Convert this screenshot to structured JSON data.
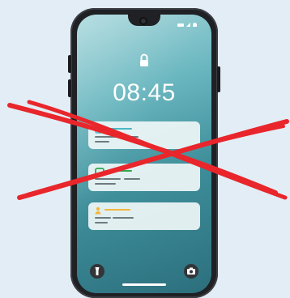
{
  "lock_screen": {
    "time": "08:45",
    "icons": {
      "lock": "lock-icon",
      "flashlight": "flashlight-icon",
      "camera": "camera-icon",
      "battery": "battery-icon",
      "signal": "signal-icon",
      "wifi": "wifi-icon"
    },
    "notifications": [
      {
        "icon": "message-icon",
        "accent": "#4bb8c4"
      },
      {
        "icon": "chat-icon",
        "accent": "#2fa84f"
      },
      {
        "icon": "user-icon",
        "accent": "#f2b63c"
      }
    ]
  },
  "overlay": {
    "icon": "red-cross-icon",
    "color": "#e8262b"
  },
  "colors": {
    "background": "#e3edf5",
    "phone_body": "#1f2124",
    "screen_top": "#a8d8dc",
    "screen_bottom": "#2c6f7d"
  }
}
